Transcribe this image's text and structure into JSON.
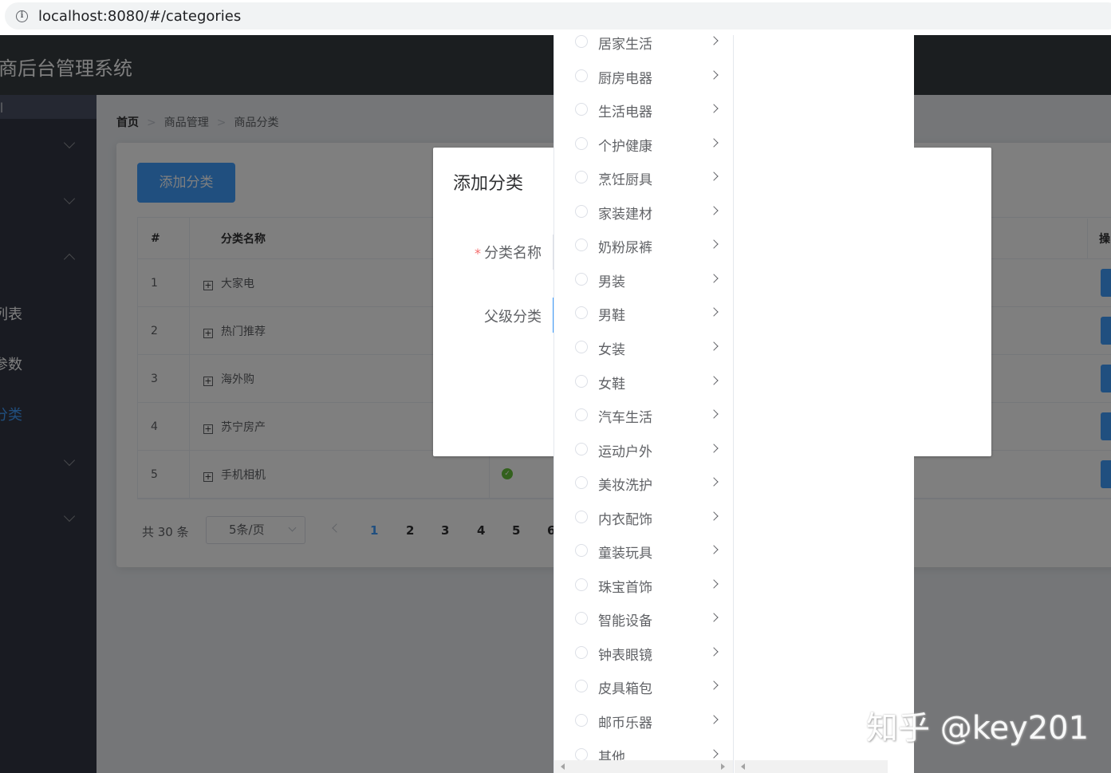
{
  "browser": {
    "url": "localhost:8080/#/categories"
  },
  "app": {
    "header_title": "商后台管理系统",
    "sidebar": {
      "items": [
        {
          "label": ""
        },
        {
          "label": ""
        },
        {
          "label": ""
        },
        {
          "label": "列表"
        },
        {
          "label": "参数"
        },
        {
          "label": "分类"
        },
        {
          "label": ""
        },
        {
          "label": ""
        }
      ]
    },
    "breadcrumb": [
      "首页",
      "商品管理",
      "商品分类"
    ],
    "add_button": "添加分类",
    "table": {
      "headers": [
        "#",
        "分类名称",
        "操"
      ],
      "rows": [
        {
          "index": "1",
          "name": "大家电"
        },
        {
          "index": "2",
          "name": "热门推荐"
        },
        {
          "index": "3",
          "name": "海外购"
        },
        {
          "index": "4",
          "name": "苏宁房产"
        },
        {
          "index": "5",
          "name": "手机相机"
        }
      ]
    },
    "pagination": {
      "total": "共 30 条",
      "page_size": "5条/页",
      "pages": [
        "1",
        "2",
        "3",
        "4",
        "5",
        "6"
      ],
      "current_page": "1"
    }
  },
  "dialog": {
    "title": "添加分类",
    "name_label": "分类名称",
    "required_mark": "*",
    "parent_label": "父级分类"
  },
  "cascader": {
    "options": [
      "居家生活",
      "厨房电器",
      "生活电器",
      "个护健康",
      "烹饪厨具",
      "家装建材",
      "奶粉尿裤",
      "男装",
      "男鞋",
      "女装",
      "女鞋",
      "汽车生活",
      "运动户外",
      "美妆洗护",
      "内衣配饰",
      "童装玩具",
      "珠宝首饰",
      "智能设备",
      "钟表眼镜",
      "皮具箱包",
      "邮币乐器",
      "其他"
    ]
  },
  "watermark": "知乎 @key201",
  "colors": {
    "primary": "#409eff",
    "header": "#373d41",
    "sidebar": "#333744",
    "success": "#67c23a",
    "danger": "#f56c6c"
  }
}
